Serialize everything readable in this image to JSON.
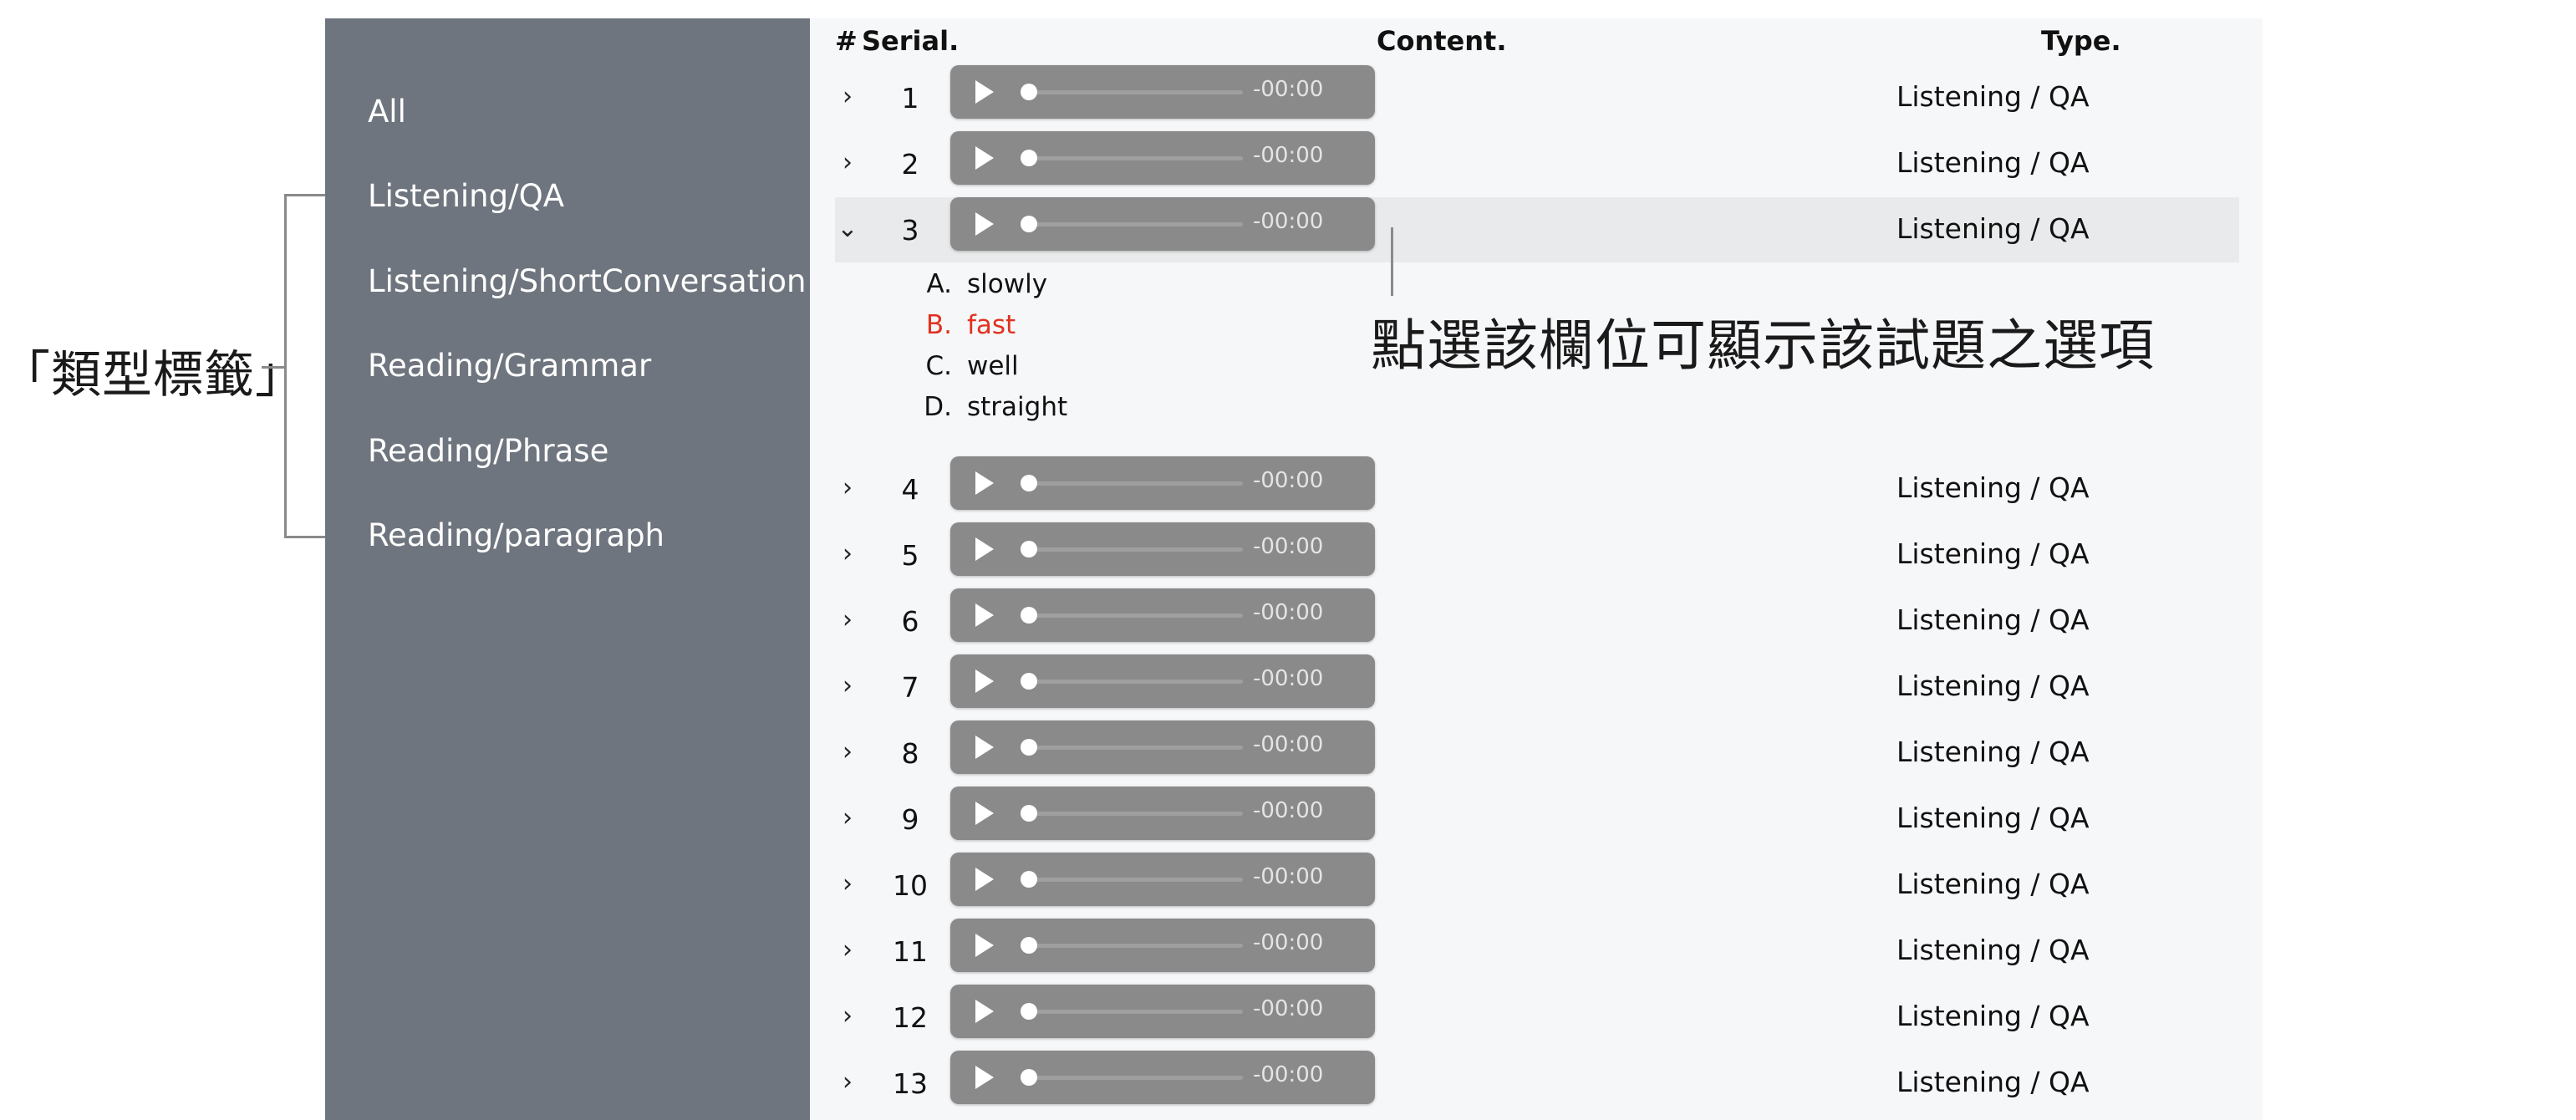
{
  "annotations": {
    "type_tags_label": "「類型標籤」",
    "callout_text": "點選該欄位可顯示該試題之選項"
  },
  "sidebar": {
    "items": [
      {
        "label": "All"
      },
      {
        "label": "Listening/QA"
      },
      {
        "label": "Listening/ShortConversation"
      },
      {
        "label": "Reading/Grammar"
      },
      {
        "label": "Reading/Phrase"
      },
      {
        "label": "Reading/paragraph"
      }
    ]
  },
  "table": {
    "headers": {
      "index": "#",
      "serial": "Serial.",
      "content": "Content.",
      "type": "Type."
    },
    "rows": [
      {
        "serial": "1",
        "time": "-00:00",
        "type": "Listening / QA",
        "expanded": false
      },
      {
        "serial": "2",
        "time": "-00:00",
        "type": "Listening / QA",
        "expanded": false
      },
      {
        "serial": "3",
        "time": "-00:00",
        "type": "Listening / QA",
        "expanded": true
      },
      {
        "serial": "4",
        "time": "-00:00",
        "type": "Listening / QA",
        "expanded": false
      },
      {
        "serial": "5",
        "time": "-00:00",
        "type": "Listening / QA",
        "expanded": false
      },
      {
        "serial": "6",
        "time": "-00:00",
        "type": "Listening / QA",
        "expanded": false
      },
      {
        "serial": "7",
        "time": "-00:00",
        "type": "Listening / QA",
        "expanded": false
      },
      {
        "serial": "8",
        "time": "-00:00",
        "type": "Listening / QA",
        "expanded": false
      },
      {
        "serial": "9",
        "time": "-00:00",
        "type": "Listening / QA",
        "expanded": false
      },
      {
        "serial": "10",
        "time": "-00:00",
        "type": "Listening / QA",
        "expanded": false
      },
      {
        "serial": "11",
        "time": "-00:00",
        "type": "Listening / QA",
        "expanded": false
      },
      {
        "serial": "12",
        "time": "-00:00",
        "type": "Listening / QA",
        "expanded": false
      },
      {
        "serial": "13",
        "time": "-00:00",
        "type": "Listening / QA",
        "expanded": false
      }
    ],
    "expanded_options": [
      {
        "letter": "A.",
        "text": "slowly",
        "correct": false
      },
      {
        "letter": "B.",
        "text": "fast",
        "correct": true
      },
      {
        "letter": "C.",
        "text": "well",
        "correct": false
      },
      {
        "letter": "D.",
        "text": "straight",
        "correct": false
      }
    ]
  },
  "icons": {
    "collapsed": "chevron-right-icon",
    "expanded": "chevron-down-icon",
    "play": "play-icon"
  },
  "colors": {
    "sidebar_bg": "#6f757e",
    "main_bg": "#f6f7f9",
    "player_bg": "#8a8a8a",
    "correct_answer": "#e0321f",
    "expanded_row_bg": "#e9eaeb"
  }
}
